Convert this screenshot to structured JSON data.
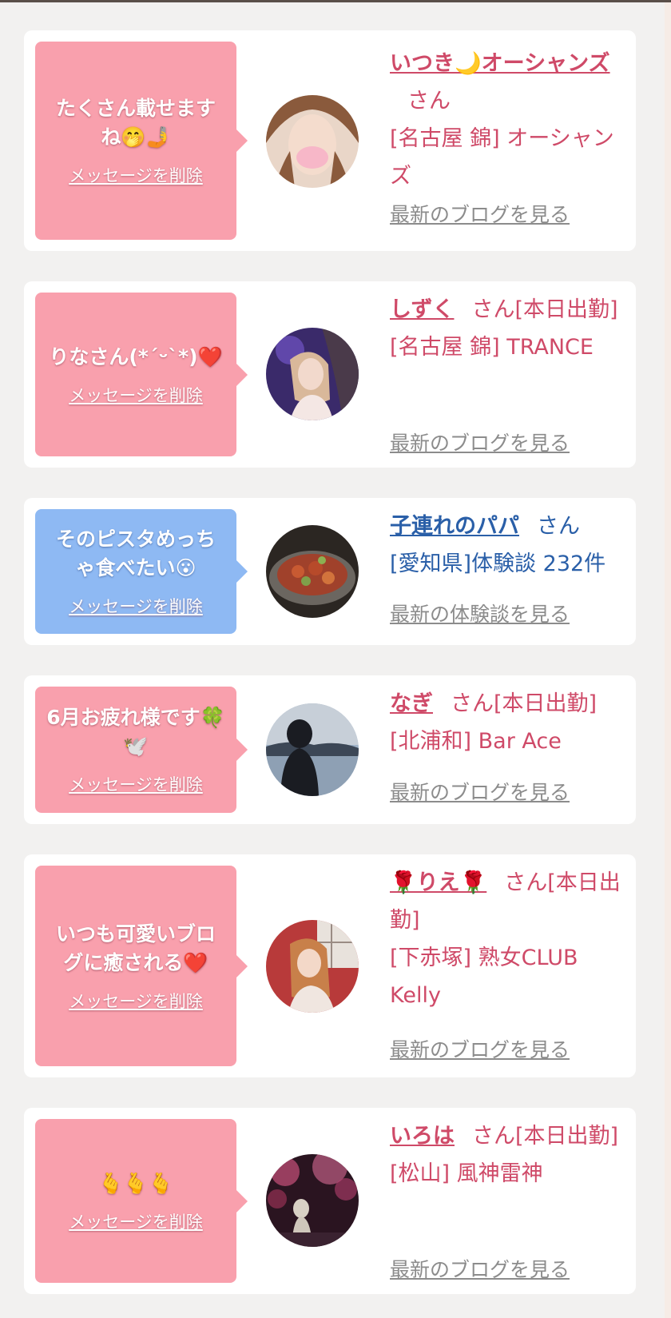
{
  "cards": [
    {
      "message": "たくさん載せますね🤭🤳",
      "delete_label": "メッセージを削除",
      "name": "いつき🌙オーシャンズ",
      "honorific": "さん",
      "shop": "[名古屋 錦] オーシャンズ",
      "link": "最新のブログを見る",
      "theme": "pink"
    },
    {
      "message": "りなさん(*´ᵕ`*)❤️",
      "delete_label": "メッセージを削除",
      "name": "しずく",
      "honorific": "さん[本日出勤]",
      "shop": "[名古屋 錦] TRANCE",
      "link": "最新のブログを見る",
      "theme": "pink"
    },
    {
      "message": "そのピスタめっちゃ食べたい😮",
      "delete_label": "メッセージを削除",
      "name": "子連れのパパ",
      "honorific": "さん",
      "shop": "[愛知県]体験談 232件",
      "link": "最新の体験談を見る",
      "theme": "blue"
    },
    {
      "message": "6月お疲れ様です🍀🕊️",
      "delete_label": "メッセージを削除",
      "name": "なぎ",
      "honorific": "さん[本日出勤]",
      "shop": "[北浦和] Bar Ace",
      "link": "最新のブログを見る",
      "theme": "pink"
    },
    {
      "message": "いつも可愛いブログに癒される❤️",
      "delete_label": "メッセージを削除",
      "name": "🌹りえ🌹",
      "honorific": "さん[本日出勤]",
      "shop": "[下赤塚] 熟女CLUB Kelly",
      "link": "最新のブログを見る",
      "theme": "pink"
    },
    {
      "message": "🫰🫰🫰",
      "delete_label": "メッセージを削除",
      "name": "いろは",
      "honorific": "さん[本日出勤]",
      "shop": "[松山] 風神雷神",
      "link": "最新のブログを見る",
      "theme": "pink"
    }
  ],
  "colors": {
    "pink_bubble": "#f9a0ad",
    "blue_bubble": "#8eb9f3",
    "pink_text": "#cf4a68",
    "blue_text": "#2a5fa8",
    "link_gray": "#8c8c8c"
  }
}
